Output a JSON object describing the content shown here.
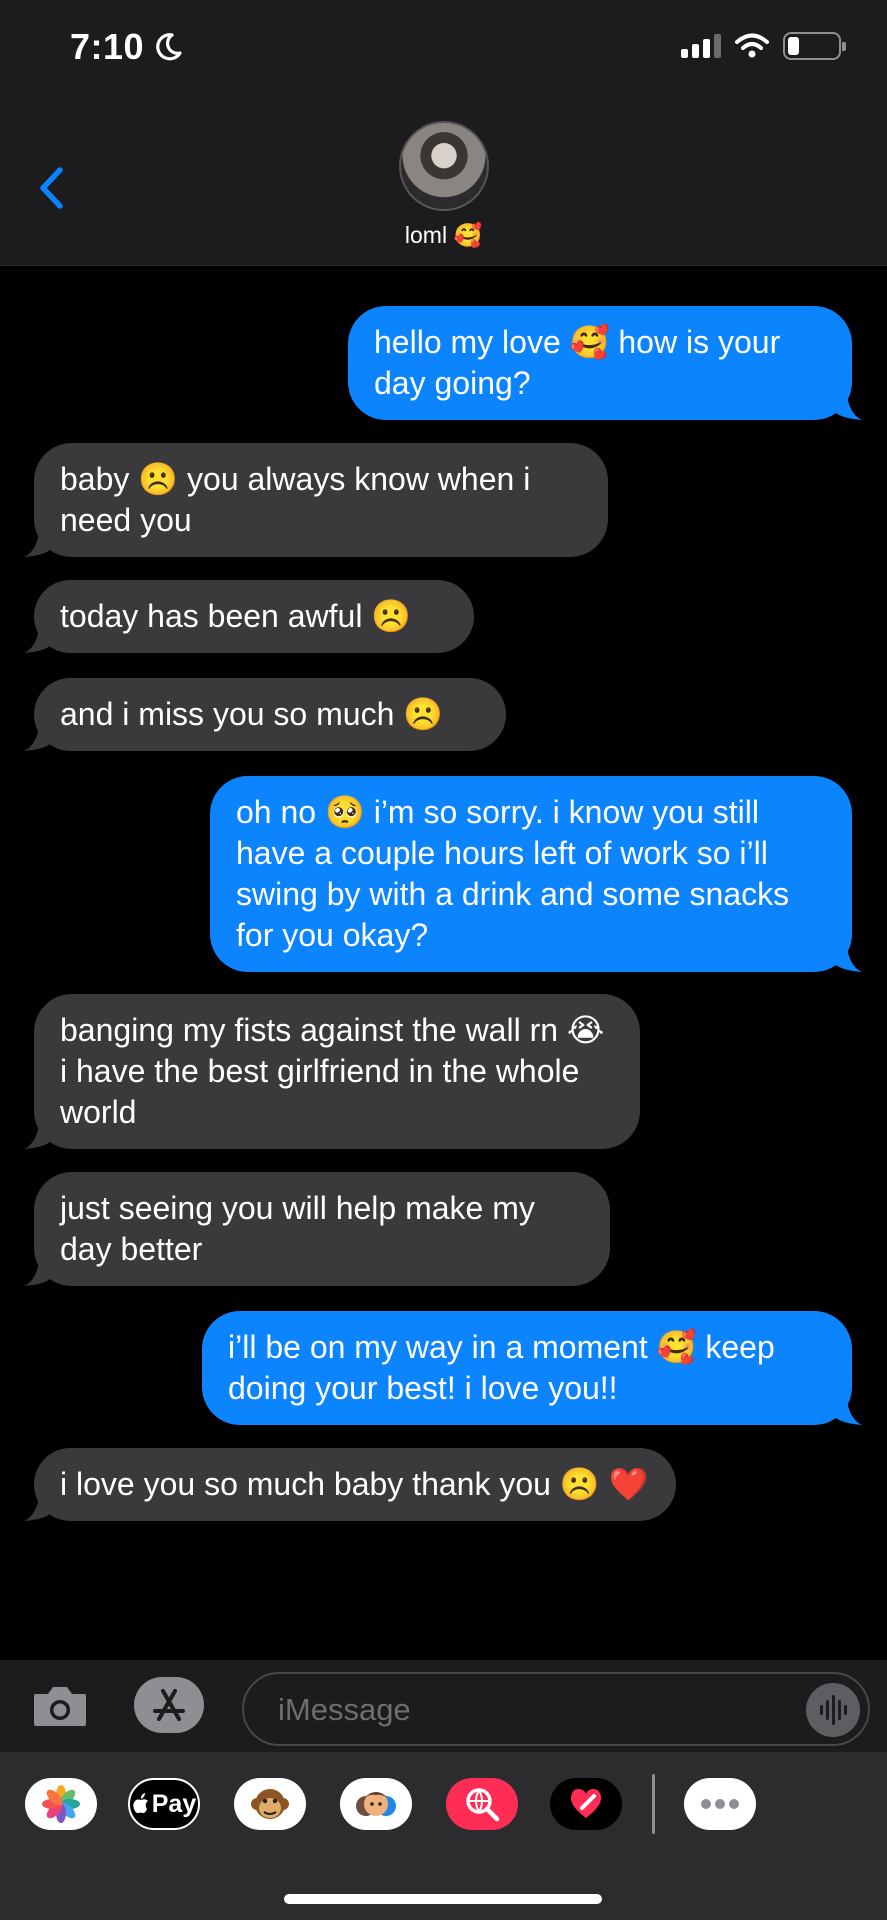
{
  "status_bar": {
    "time": "7:10"
  },
  "header": {
    "contact_name": "loml 🥰"
  },
  "messages": [
    {
      "side": "out",
      "text": "hello my love 🥰 how is your day going?"
    },
    {
      "side": "in",
      "text": "baby ☹️ you always know when i need you"
    },
    {
      "side": "in",
      "text": "today has been awful ☹️"
    },
    {
      "side": "in",
      "text": "and i miss you so much ☹️"
    },
    {
      "side": "out",
      "text": "oh no 🥺 i’m so sorry. i know you still have a couple hours left of work so i’ll swing by with a drink and some snacks for you okay?"
    },
    {
      "side": "in",
      "text": "banging my fists against the wall rn 😭 i have the best girlfriend in the whole world"
    },
    {
      "side": "in",
      "text": "just seeing you will help make my day better"
    },
    {
      "side": "out",
      "text": "i’ll be on my way in a moment 🥰 keep doing your best! i love you!!"
    },
    {
      "side": "in",
      "text": "i love you so much baby thank you ☹️ ❤️"
    }
  ],
  "composer": {
    "placeholder": "iMessage"
  },
  "app_strip": {
    "apple_pay_label": "Pay",
    "icons": [
      "photos-icon",
      "apple-pay-icon",
      "animoji-icon",
      "memoji-icon",
      "image-search-icon",
      "digital-touch-icon",
      "more-icon"
    ]
  },
  "colors": {
    "outgoing_bubble": "#0b84fe",
    "incoming_bubble": "#3a3a3c",
    "accent": "#0a84ff",
    "background": "#000000"
  }
}
